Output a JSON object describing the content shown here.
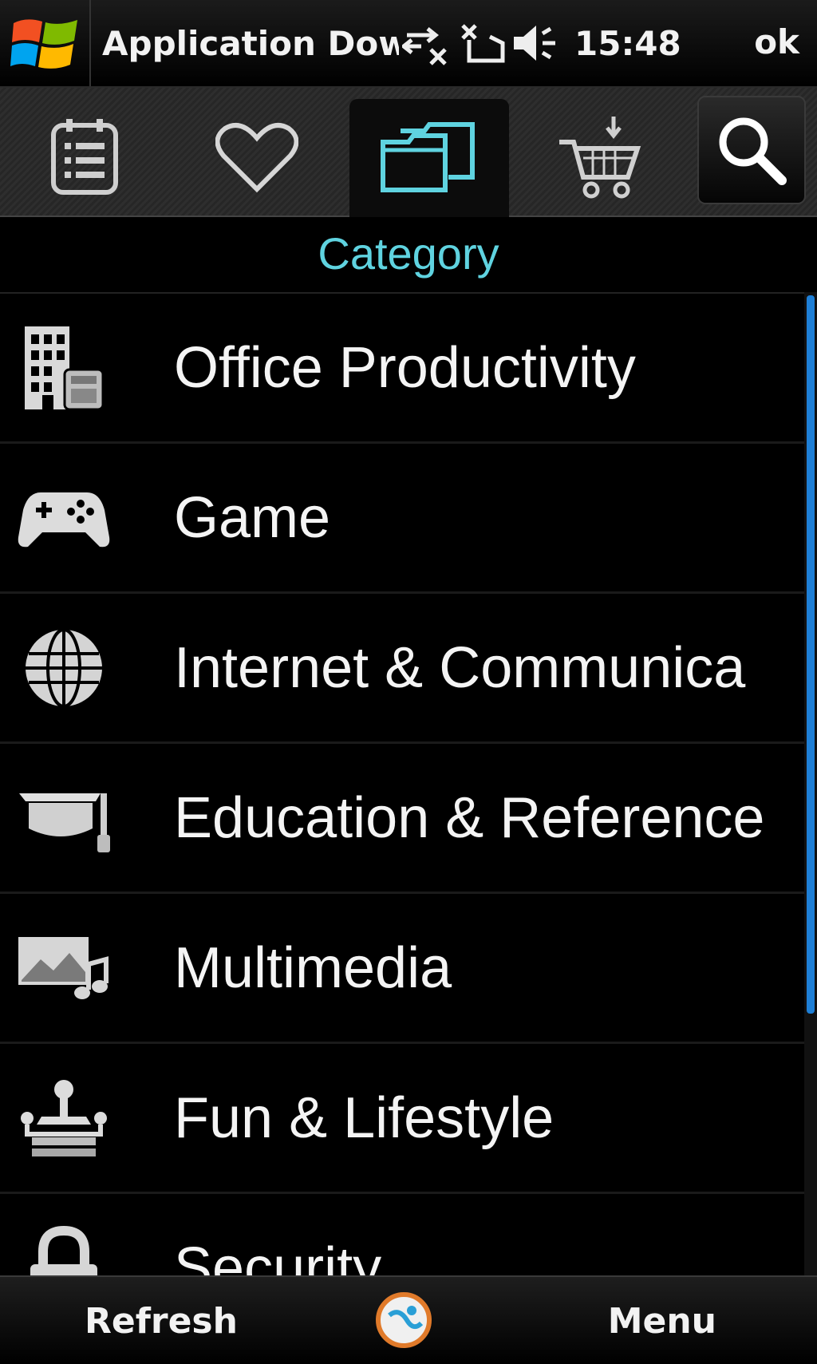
{
  "status_bar": {
    "app_title": "Application Dow",
    "time": "15:48",
    "ok_label": "ok"
  },
  "tabs": [
    {
      "name": "list",
      "icon": "list-icon",
      "active": false
    },
    {
      "name": "favorites",
      "icon": "heart-icon",
      "active": false
    },
    {
      "name": "category",
      "icon": "folders-icon",
      "active": true
    },
    {
      "name": "cart",
      "icon": "cart-download-icon",
      "active": false
    },
    {
      "name": "search",
      "icon": "search-icon",
      "active": false
    }
  ],
  "section_title": "Category",
  "categories": [
    {
      "label": "Office Productivity",
      "icon": "office-building-icon"
    },
    {
      "label": "Game",
      "icon": "gamepad-icon"
    },
    {
      "label": "Internet & Communica",
      "icon": "globe-icon"
    },
    {
      "label": "Education & Reference",
      "icon": "graduation-cap-icon"
    },
    {
      "label": "Multimedia",
      "icon": "picture-music-icon"
    },
    {
      "label": "Fun & Lifestyle",
      "icon": "joystick-icon"
    },
    {
      "label": "Security",
      "icon": "padlock-icon"
    }
  ],
  "soft_keys": {
    "left": "Refresh",
    "right": "Menu"
  },
  "colors": {
    "accent": "#5fd3e0",
    "scrollbar": "#1e7fd6",
    "background": "#000000"
  }
}
